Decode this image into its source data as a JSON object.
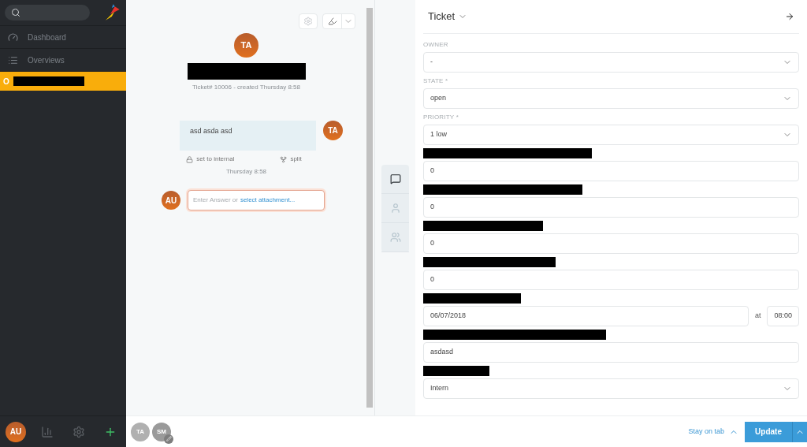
{
  "sidebar": {
    "nav": [
      {
        "kind": "dashboard",
        "label": "Dashboard"
      },
      {
        "kind": "overviews",
        "label": "Overviews"
      }
    ],
    "open_tickets": [
      {
        "marker": "O",
        "selected": true,
        "title_redacted": true
      }
    ],
    "footer": {
      "avatar": "AU"
    }
  },
  "conversation": {
    "header": {
      "avatar": "TA",
      "title_redacted": true,
      "meta": "Ticket# 10006 - created Thursday 8:58"
    },
    "articles": [
      {
        "avatar": "TA",
        "body": "asd asda asd",
        "actions": [
          {
            "kind": "lock",
            "label": "set to internal"
          },
          {
            "kind": "split",
            "label": "split"
          }
        ],
        "time": "Thursday 8:58"
      }
    ],
    "reply": {
      "avatar": "AU",
      "placeholder": "Enter Answer or",
      "attachment_link": "select attachment..."
    }
  },
  "side_tabs": [
    {
      "kind": "ticket",
      "selected": true
    },
    {
      "kind": "customer",
      "selected": false
    },
    {
      "kind": "organization",
      "selected": false
    }
  ],
  "ticket_panel": {
    "title": "Ticket",
    "fields": [
      {
        "kind": "select",
        "label": "OWNER",
        "value": "-"
      },
      {
        "kind": "select",
        "label": "STATE *",
        "value": "open"
      },
      {
        "kind": "select",
        "label": "PRIORITY *",
        "value": "1 low"
      },
      {
        "kind": "input",
        "label_redacted": true,
        "value": "0"
      },
      {
        "kind": "input",
        "label_redacted": true,
        "value": "0"
      },
      {
        "kind": "input",
        "label_redacted": true,
        "value": "0"
      },
      {
        "kind": "input",
        "label_redacted": true,
        "value": "0"
      },
      {
        "kind": "datetime",
        "label_redacted": true,
        "value": "06/07/2018",
        "at": "at",
        "time": "08:00"
      },
      {
        "kind": "input",
        "label_redacted": true,
        "value": "asdasd"
      },
      {
        "kind": "select",
        "label_redacted": true,
        "value": "Intern"
      }
    ]
  },
  "bottom_bar": {
    "viewers": [
      {
        "initials": "TA",
        "editing": false
      },
      {
        "initials": "SM",
        "editing": true
      }
    ],
    "stay_on_tab": "Stay on tab",
    "update": "Update"
  }
}
